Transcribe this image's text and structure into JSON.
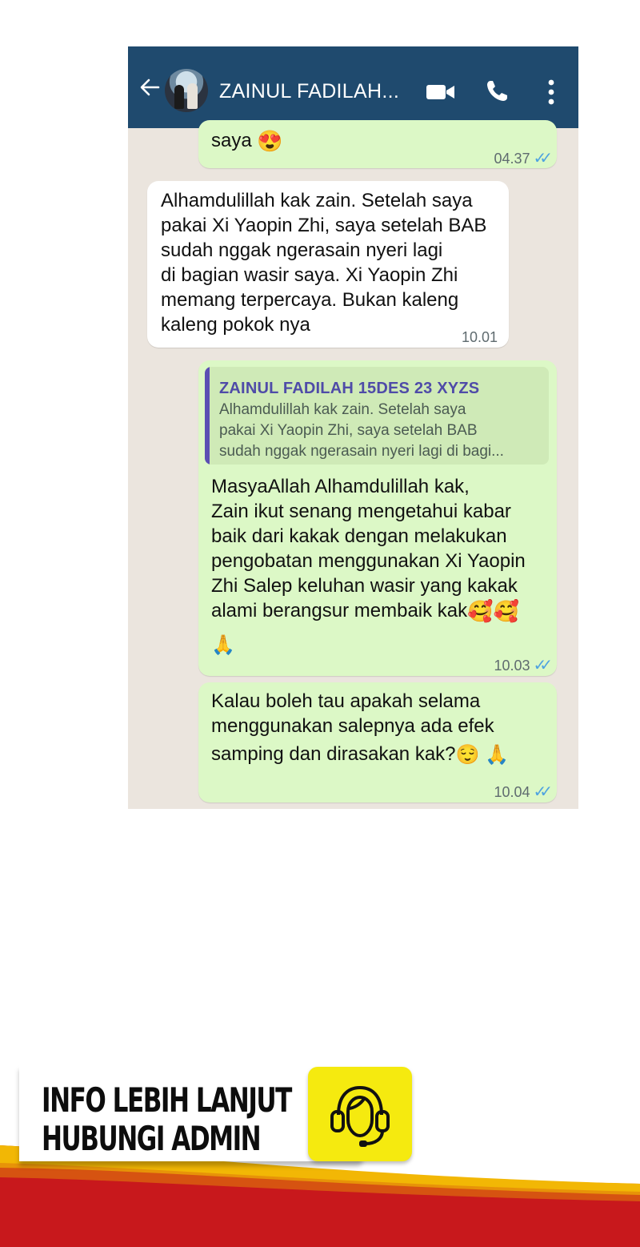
{
  "header": {
    "contact_name": "ZAINUL FADILAH...",
    "icons": [
      "back-arrow-icon",
      "avatar",
      "video-call-icon",
      "phone-call-icon",
      "more-vert-icon"
    ]
  },
  "messages": [
    {
      "direction": "out",
      "text": "saya",
      "emoji": "😍",
      "time": "04.37",
      "ticks": "✓✓"
    },
    {
      "direction": "in",
      "lines": [
        "Alhamdulillah kak zain. Setelah saya",
        "pakai Xi Yaopin Zhi, saya setelah BAB",
        "sudah nggak ngerasain nyeri lagi",
        "di bagian wasir saya. Xi Yaopin Zhi",
        "memang terpercaya. Bukan kaleng",
        "kaleng pokok nya"
      ],
      "time": "10.01"
    },
    {
      "direction": "out",
      "quote": {
        "name": "ZAINUL FADILAH 15DES 23 XYZS",
        "text": "Alhamdulillah kak zain. Setelah saya\npakai Xi Yaopin Zhi, saya setelah BAB\nsudah nggak ngerasain nyeri lagi di bagi..."
      },
      "lines": [
        "MasyaAllah Alhamdulillah kak,",
        "Zain ikut senang mengetahui kabar",
        "baik dari kakak dengan melakukan",
        "pengobatan menggunakan Xi Yaopin",
        "Zhi Salep keluhan wasir yang kakak",
        "alami berangsur membaik kak"
      ],
      "emoji_end": "🥰🥰",
      "emoji_next": "🙏",
      "time": "10.03",
      "ticks": "✓✓"
    },
    {
      "direction": "out",
      "lines": [
        "Kalau boleh tau apakah selama",
        "menggunakan salepnya ada efek",
        "samping dan dirasakan kak?"
      ],
      "emoji_end": "😌 🙏",
      "time": "10.04",
      "ticks": "✓✓"
    }
  ],
  "banner": {
    "text": "INFO LEBIH LANJUT\nHUBUNGI ADMIN",
    "button_icon": "headset-support-icon",
    "colors": {
      "button": "#f5ea0f",
      "stripe_red": "#c8181c",
      "stripe_yellow": "#f2b705"
    }
  }
}
